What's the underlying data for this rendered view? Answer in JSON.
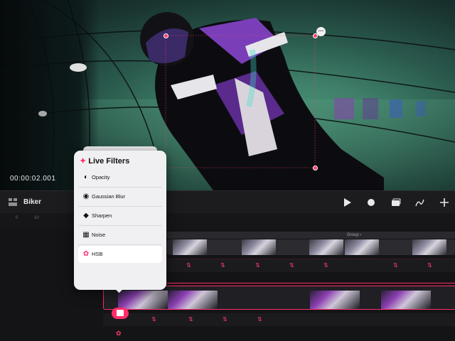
{
  "canvas": {
    "timecode": "00:00:02.001",
    "more_icon": "ellipsis-icon"
  },
  "project": {
    "name": "Biker",
    "icon": "layers-icon"
  },
  "toolbar": {
    "play_icon": "play-icon",
    "record_icon": "record-icon",
    "frames_icon": "stack-icon",
    "draw_icon": "pen-icon",
    "add_icon": "plus-icon"
  },
  "timeline": {
    "ruler_labels": [
      "0",
      "10"
    ],
    "group_label": "Group ›"
  },
  "live_filters": {
    "title": "Live Filters",
    "title_icon": "sparkle-icon",
    "items": [
      {
        "label": "Opacity",
        "icon": "opacity-icon"
      },
      {
        "label": "Gaussian Blur",
        "icon": "blur-icon"
      },
      {
        "label": "Sharpen",
        "icon": "sharpen-icon"
      },
      {
        "label": "Noise",
        "icon": "noise-icon"
      },
      {
        "label": "HSB",
        "icon": "hsb-icon",
        "selected": true
      }
    ]
  },
  "colors": {
    "accent": "#ff2d6a",
    "popover_bg": "#f0f0f2",
    "canvas_green": "#4e9b7d"
  }
}
